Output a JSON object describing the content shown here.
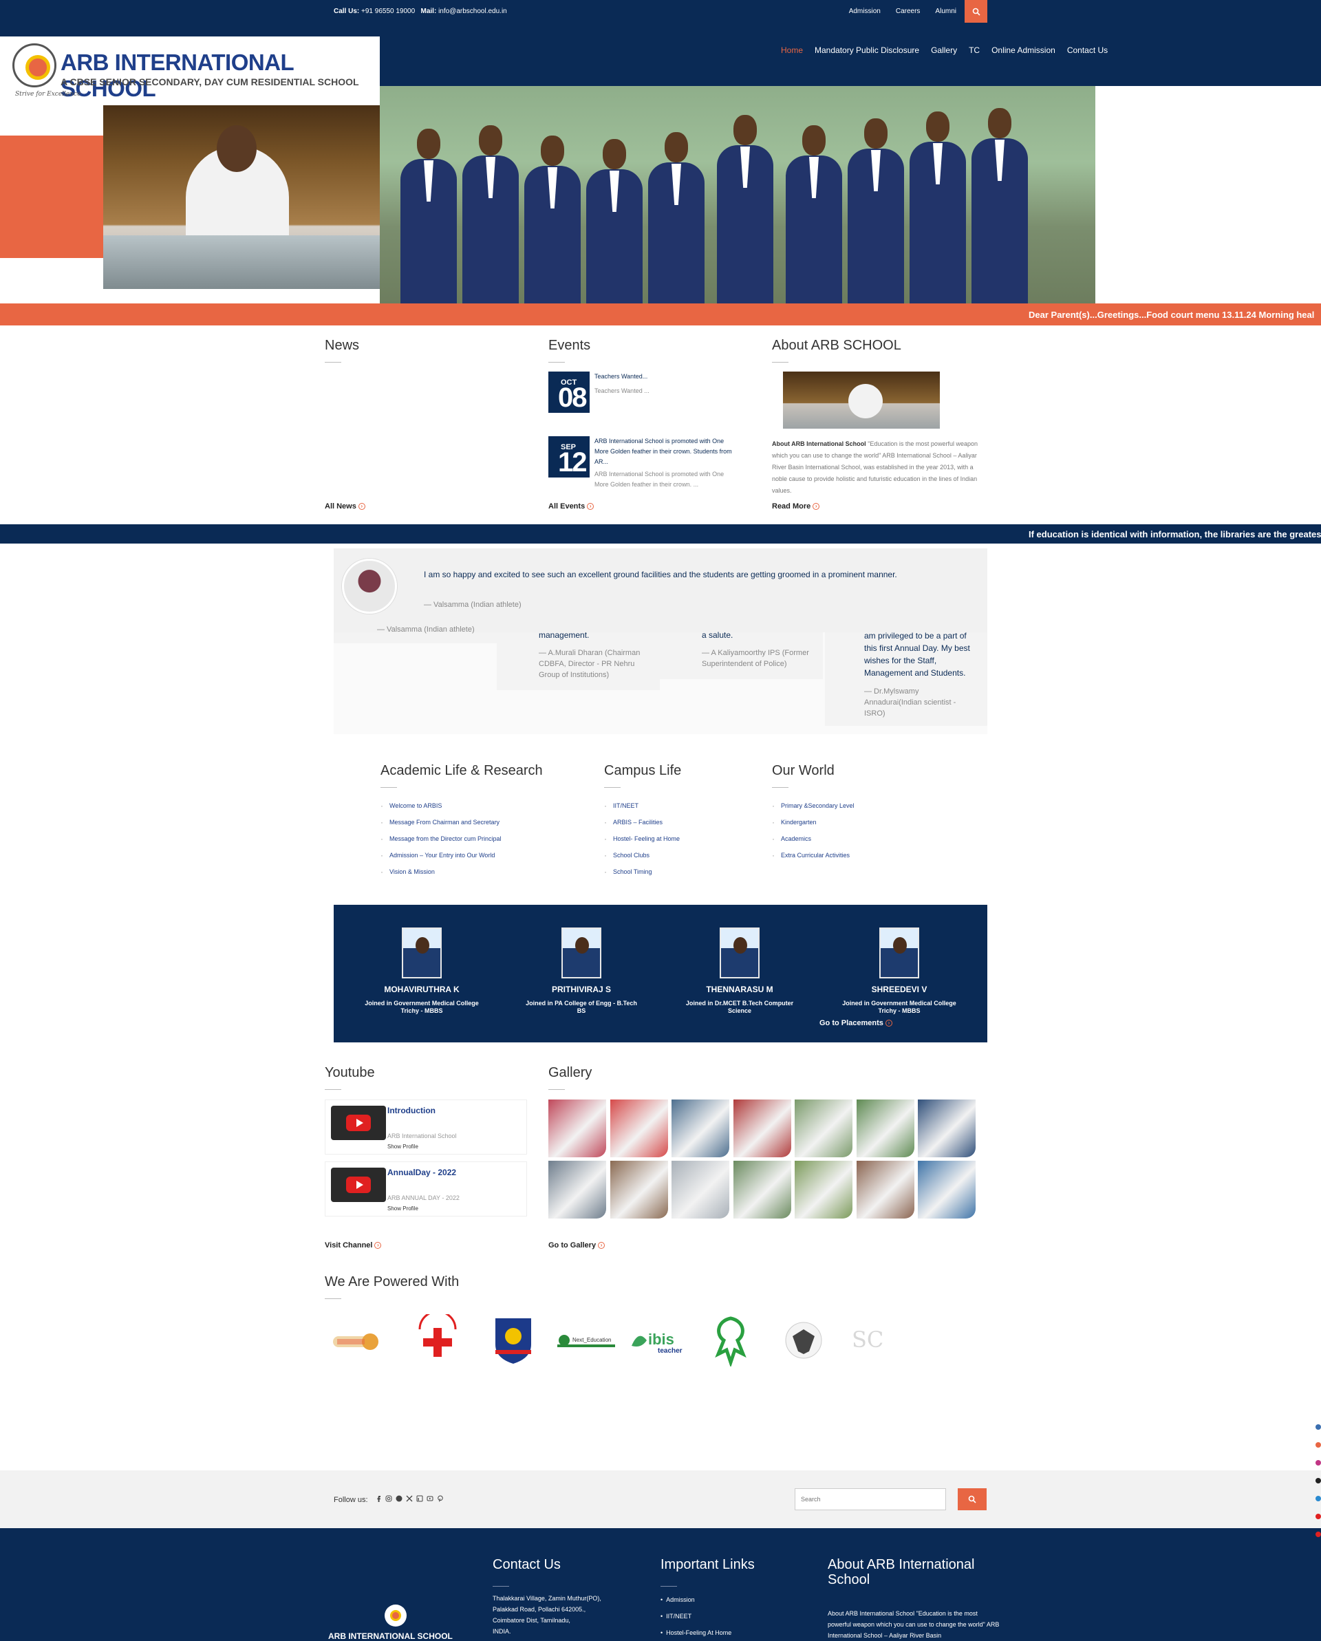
{
  "topbar": {
    "call_label": "Call Us:",
    "call_value": "+91 96550 19000",
    "mail_label": "Mail:",
    "mail_value": "info@arbschool.edu.in",
    "links": [
      "Admission",
      "Careers",
      "Alumni"
    ]
  },
  "brand": {
    "name": "ARB INTERNATIONAL SCHOOL",
    "tagline": "A CBSE SENIOR SECONDARY, DAY CUM RESIDENTIAL SCHOOL",
    "motto": "Strive for Excellence"
  },
  "nav": {
    "items": [
      "Home",
      "Mandatory Public Disclosure",
      "Gallery",
      "TC",
      "Online Admission",
      "Contact Us"
    ],
    "active": "Home"
  },
  "tickers": {
    "top": "Dear Parent(s)...Greetings...Food court menu 13.11.24 Morning heal",
    "bottom": "If education is identical with information, the libraries are the greatest sa"
  },
  "news": {
    "title": "News",
    "more": "All News"
  },
  "events": {
    "title": "Events",
    "items": [
      {
        "month": "OCT",
        "day": "08",
        "title": "Teachers Wanted...",
        "summary": "Teachers Wanted ..."
      },
      {
        "month": "SEP",
        "day": "12",
        "title": "ARB International School is promoted with One More Golden feather in their crown. Students from AR...",
        "summary": "ARB International School is promoted with One More Golden feather in their crown. ..."
      }
    ],
    "more": "All Events"
  },
  "about": {
    "title": "About ARB SCHOOL",
    "lead": "About ARB International School",
    "text": "\"Education is the most powerful weapon which you can use to change the world\" ARB International School – Aaliyar River Basin International School, was established in the year 2013, with a noble cause to provide holistic and futuristic education in the lines of Indian values.",
    "more": "Read More"
  },
  "testimonials": {
    "main": {
      "quote": "I am so happy and excited to see such an excellent ground facilities and the students are getting groomed in a prominent manner.",
      "author": "— Valsamma (Indian athlete)"
    },
    "cards": [
      {
        "quote": "",
        "author": "— Valsamma (Indian athlete)"
      },
      {
        "quote": "management.",
        "author": "— A.Murali Dharan (Chairman CDBFA, Director - PR Nehru Group of Institutions)"
      },
      {
        "quote": "a salute.",
        "author": "— A Kaliyamoorthy IPS (Former Superintendent of Police)"
      },
      {
        "quote": "am privileged to be a part of this first Annual Day. My best wishes for the Staff, Management and Students.",
        "author": "— Dr.Mylswamy Annadurai(Indian scientist - ISRO)"
      }
    ]
  },
  "links": {
    "academic": {
      "title": "Academic Life & Research",
      "items": [
        "Welcome to ARBIS",
        "Message From Chairman and Secretary",
        "Message from the Director cum Principal",
        "Admission – Your Entry into Our World",
        "Vision & Mission"
      ]
    },
    "campus": {
      "title": "Campus Life",
      "items": [
        "IIT/NEET",
        "ARBIS – Facilities",
        "Hostel- Feeling at Home",
        "School Clubs",
        "School Timing"
      ]
    },
    "world": {
      "title": "Our World",
      "items": [
        "Primary &Secondary Level",
        "Kindergarten",
        "Academics",
        "Extra Curricular Activities"
      ]
    }
  },
  "placements": {
    "students": [
      {
        "name": "MOHAVIRUTHRA K",
        "desc": "Joined in Government Medical College Trichy - MBBS"
      },
      {
        "name": "PRITHIVIRAJ S",
        "desc": "Joined in PA College of Engg - B.Tech BS"
      },
      {
        "name": "THENNARASU M",
        "desc": "Joined in Dr.MCET B.Tech Computer Science"
      },
      {
        "name": "SHREEDEVI V",
        "desc": "Joined in Government Medical College Trichy - MBBS"
      }
    ],
    "more": "Go to Placements"
  },
  "youtube": {
    "title": "Youtube",
    "videos": [
      {
        "title": "Introduction",
        "channel": "ARB International School",
        "action": "Show Profile"
      },
      {
        "title": "AnnualDay - 2022",
        "channel": "ARB ANNUAL DAY - 2022",
        "action": "Show Profile"
      }
    ],
    "more": "Visit Channel"
  },
  "gallery": {
    "title": "Gallery",
    "more": "Go to Gallery",
    "colors": [
      "#c0485a",
      "#d64a4a",
      "#4d6f8f",
      "#b03a3a",
      "#7a9a6a",
      "#5e8a52",
      "#2f4f7a",
      "#6e7d8c",
      "#8a6a52",
      "#a8b0b8",
      "#6a8a5e",
      "#7b9a5a",
      "#8a6450",
      "#3f74a8"
    ]
  },
  "powered": {
    "title": "We Are Powered With",
    "logos": [
      "sports-trophy-logo",
      "junior-red-cross-logo",
      "ncc-logo",
      "next-education-logo",
      "ibis-teacher-logo",
      "scouts-logo",
      "eagle-emblem-logo",
      "sc-logo"
    ],
    "labels": {
      "next": "Next_Education",
      "ibis": "ibis",
      "ibis_sub": "teacher",
      "sc": "SC"
    }
  },
  "footer": {
    "follow_label": "Follow us:",
    "search_placeholder": "Search",
    "brand": "ARB INTERNATIONAL SCHOOL",
    "contact": {
      "title": "Contact Us",
      "address": [
        "Thalakkarai Village, Zamin Muthur(PO),",
        "Palakkad Road, Pollachi 642005.,",
        "Coimbatore Dist, Tamilnadu,",
        "INDIA."
      ]
    },
    "important": {
      "title": "Important Links",
      "items": [
        "Admission",
        "IIT/NEET",
        "Hostel-Feeling At Home"
      ]
    },
    "about": {
      "title": "About ARB International School",
      "text": "About ARB International School \"Education is the most powerful weapon which you can use to change the world\" ARB International School – Aaliyar River Basin"
    }
  }
}
